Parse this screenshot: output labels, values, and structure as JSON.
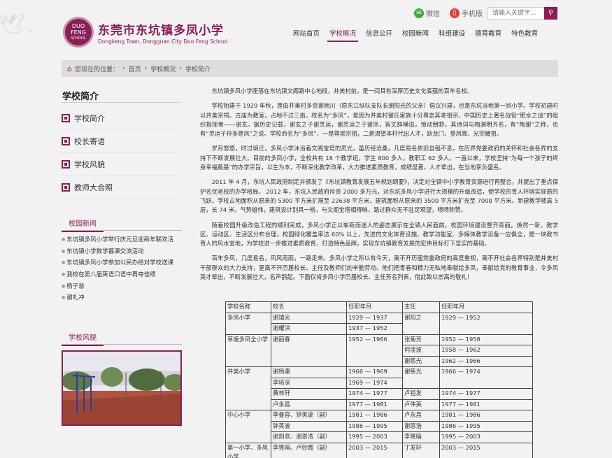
{
  "header": {
    "logo_badge_line1": "DUO",
    "logo_badge_line2": "FENG",
    "logo_badge_line3": "SCHOOL",
    "logo_cn": "东莞市东坑镇多凤小学",
    "logo_en": "Dongkeng Town, Dongguan City Duo Feng School",
    "weixin_label": "微信",
    "mobile_label": "手机版",
    "search_placeholder": "请输入关键字..."
  },
  "nav": [
    "网站首页",
    "学校概况",
    "信息公开",
    "校园新闻",
    "科组建设",
    "德育教育",
    "特色教育"
  ],
  "nav_active": 1,
  "breadcrumb": {
    "lead": "您现在的位置：",
    "sep": "›",
    "items": [
      "首页",
      "学校概况",
      "学校简介"
    ]
  },
  "sidebar": {
    "title": "学校简介",
    "menu": [
      "学校简介",
      "校长寄语",
      "学校风貌",
      "教师大合照"
    ],
    "news_title": "校园新闻",
    "news": [
      "东坑镇多凤小学举行庆元旦迎新年联欢活",
      "东坑镇小学数学暮课交流活动",
      "东坑镇多凤小学参加公民办结对学校送课",
      "我校在第八届英语口语中再夺佳绩",
      "杨子慧",
      "谢礼冲"
    ],
    "photo_title": "学校风貌"
  },
  "article": {
    "paragraphs": [
      "东坑镇多凤小学座落在东坑镇文阁路中心地段，井美村前，是一间具有深厚历史文化底蕴的百年名校。",
      "学校始建于 1929 年秋，是由井美村多资谢雨川（原东江纵队支队长谢阳光的父亲）倡议兴建，也是东坑当地第一间小学。学校初建时以井美宗祠、古庙为教室，占地不过三亩。校名为“多凤”，是因为井美村谢氏家族十分尊崇其老祖宗、中国历史上著名战役“肥水之战”的组织指挥者——谢玄。据历史记载，谢玄之子谢灵运，谢灵运之子谢凤，皆文辞横溢，惊动朝野。其诗词与陶渊明齐名，有“陶谢”之称，也有“灵运子孙多是凤”之说。学校命名为“多凤”，一是尊崇宗祖，二是渴望本村代出人才，跃龙门、登凤阁、光宗耀祖。",
      "岁月悠悠，时过境迁，多凤小学沐浴着文阁宝塔的灵光，虽历经沧桑，几度易名依旧自强不息，在历界党委政府的关怀和社会各界的支持下不断发展壮大。目前的多凤小学，全校共有 18 个教学班，学生 800 多人，教职工 62 多人。一直以来，学校坚持“为每一个孩子的终身幸福奠基”的办学宗旨，以生为本，不断深化教学改革，大力推进素质教育，成绩显著，人才辈出，在当地享负盛名。",
      "2011 年 4 月，东坑人民政府制定并颁发了《东坑镇教育发展五年规划纲要》，决定对全镇中小学教育资源进行再整合，并提出了重点保护名优老校的办学格局。 2012 年，东坑人民政府斥资 2000 多万元，对东坑多凤小学进行大规模的升级改造，使学校的育人环境实现质的飞跃。学校占地面积从原来的 5300 平方米扩展至 22638 平方米，建筑面积从原来的 3500 平方米扩充至 7000 平方米。新建教学楼高 5 层，长 74 米，气势雄伟，建筑设计别具一格，与文阁宝塔相得映，路过群众无不驻足观望，啧啧称赞。",
      "随着校园升级改造工程的顺利完成，多凤小学正以崭新而迷人的姿态展示在全镇人民面前。校园环境建设整齐亮丽，焕然一新。教学区、运动区、生活区分布合理，校园绿化覆盖率达 60% 以上，先进的文化体育设施、教学功能室、多媒体教学设备一应俱全，是一块教书育人的风水宝地，为学校进一步推进素质教育、打造特色品牌，实现东坑镇教育发展的宏伟目标打下坚实的基础。",
      "百年多凤，几度易名，风风雨雨，一路走来。多凤小学之所以有今天，离不开历届党委政府的高度重视，离不开社会各界特别是井美村干部群众的大力支持，更离不开历届校长、主任及教师们的辛勤劳动。他们把青春和精力无私地奉献给多凤，奉献给党的教育事业，令多凤英才辈出，不断发展壮大，名声鹊起。下面仅将多凤小学历届校长、主任芳名列表，借此致以崇高的敬礼！"
    ]
  },
  "table": {
    "headers": [
      "学校名称",
      "校长",
      "任职年月",
      "主任",
      "任职年月"
    ],
    "rows": [
      {
        "school": "多凤小学",
        "school_rowspan": 2,
        "principal": "谢靖光",
        "p_period": "1929 — 1937",
        "director": "谢阳之",
        "director_rowspan": 2,
        "d_period": "1929 — 1952",
        "d_rowspan": 2
      },
      {
        "principal": "谢耀洪",
        "p_period": "1937 — 1952"
      },
      {
        "school": "草塘多凤全小学",
        "school_rowspan": 3,
        "principal": "谢丽春",
        "principal_rowspan": 3,
        "p_period": "1952 — 1966",
        "p_rowspan": 3,
        "director": "张菊芳",
        "d_period": "1952 — 1958"
      },
      {
        "director": "何淦波",
        "d_period": "1958 — 1962"
      },
      {
        "director": "谢慈光",
        "d_period": "1962 — 1966"
      },
      {
        "school": "井美小学",
        "school_rowspan": 4,
        "principal": "谢杨康",
        "p_period": "1966 — 1969",
        "director": "谢慈光",
        "director_rowspan": 2,
        "d_period": "1966 — 1974",
        "d_rowspan": 2
      },
      {
        "principal": "李培深",
        "p_period": "1969 — 1974"
      },
      {
        "principal": "黄林轩",
        "p_period": "1974 — 1977",
        "director": "卢祖发",
        "d_period": "1974 — 1977"
      },
      {
        "principal": "卢永昌",
        "p_period": "1977 — 1981",
        "director": "卢伟英",
        "d_period": "1977 — 1981"
      },
      {
        "school": "中心小学",
        "school_rowspan": 3,
        "principal": "李叠容、钟英波（副）",
        "p_period": "1981 — 1986",
        "director": "卢永昌",
        "d_period": "1981 — 1986"
      },
      {
        "principal": "钟英波",
        "p_period": "1986 — 1995",
        "director": "谢恩浩",
        "d_period": "1986 — 1995"
      },
      {
        "principal": "谢刻欢、谢恩浩（副）",
        "p_period": "1995 — 2003",
        "director": "李晃暗",
        "d_period": "1995 — 2003"
      },
      {
        "school": "第一小学、多凤小学",
        "school_rowspan": 1,
        "principal": "李晃暗、卢妙霞（副）",
        "p_period": "2003 — 2015",
        "director": "丁发轩",
        "d_period": "2003 — 2015"
      }
    ]
  },
  "colors": {
    "brand": "#8a1e55",
    "weixin": "#3daa3d",
    "mobile": "#e0403a"
  }
}
